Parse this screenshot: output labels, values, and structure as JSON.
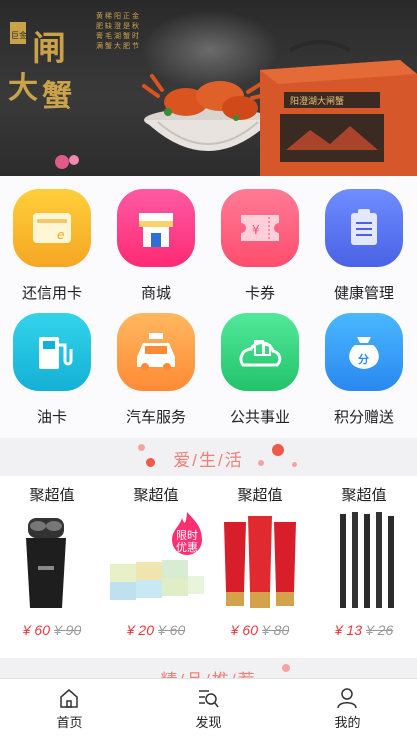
{
  "banner": {
    "calligraphy": "闸大蟹",
    "seal": "金秋 巨献",
    "poem_lines": [
      "金秋时节正是蟹肥",
      "正是蟹肥时节来",
      "阳澄湖大闸蟹",
      "稀缺毛蟹大",
      "黄肥膏满",
      "天下第一鲜"
    ],
    "box_label": "阳澄湖大闸蟹"
  },
  "services": [
    {
      "label": "还信用卡",
      "icon": "credit-card-icon",
      "colors": [
        "#ffcc33",
        "#f5a623"
      ]
    },
    {
      "label": "商城",
      "icon": "shop-icon",
      "colors": [
        "#ff4f9a",
        "#ff2d7a"
      ]
    },
    {
      "label": "卡券",
      "icon": "coupon-icon",
      "colors": [
        "#ff6b8b",
        "#ff4a6a"
      ]
    },
    {
      "label": "健康管理",
      "icon": "clipboard-icon",
      "colors": [
        "#6a8cff",
        "#4a6aef"
      ]
    },
    {
      "label": "油卡",
      "icon": "fuel-pump-icon",
      "colors": [
        "#2ed0e6",
        "#18b5d8"
      ]
    },
    {
      "label": "汽车服务",
      "icon": "taxi-icon",
      "colors": [
        "#ffb25a",
        "#ff8c3a"
      ]
    },
    {
      "label": "公共事业",
      "icon": "city-cloud-icon",
      "colors": [
        "#4ee38a",
        "#2bc66f"
      ]
    },
    {
      "label": "积分赠送",
      "icon": "points-bag-icon",
      "colors": [
        "#3fb4ff",
        "#2a8cf5"
      ]
    }
  ],
  "section1": {
    "title": "爱/生/活"
  },
  "products": [
    {
      "tag": "聚超值",
      "price": "¥ 60",
      "old_price": "¥ 90",
      "image": "electric-shaver"
    },
    {
      "tag": "聚超值",
      "price": "¥ 20",
      "old_price": "¥ 60",
      "image": "tissue-boxes",
      "badge": "限时优惠"
    },
    {
      "tag": "聚超值",
      "price": "¥ 60",
      "old_price": "¥ 80",
      "image": "bb-cream-tubes"
    },
    {
      "tag": "聚超值",
      "price": "¥ 13",
      "old_price": "¥ 26",
      "image": "eyeliner-pencils"
    }
  ],
  "section2": {
    "title": "精/品/推/荐"
  },
  "nav": [
    {
      "label": "首页",
      "icon": "home-icon"
    },
    {
      "label": "发现",
      "icon": "discover-icon"
    },
    {
      "label": "我的",
      "icon": "user-icon"
    }
  ],
  "colors": {
    "accent": "#e8383d",
    "section_title": "#f08078"
  }
}
